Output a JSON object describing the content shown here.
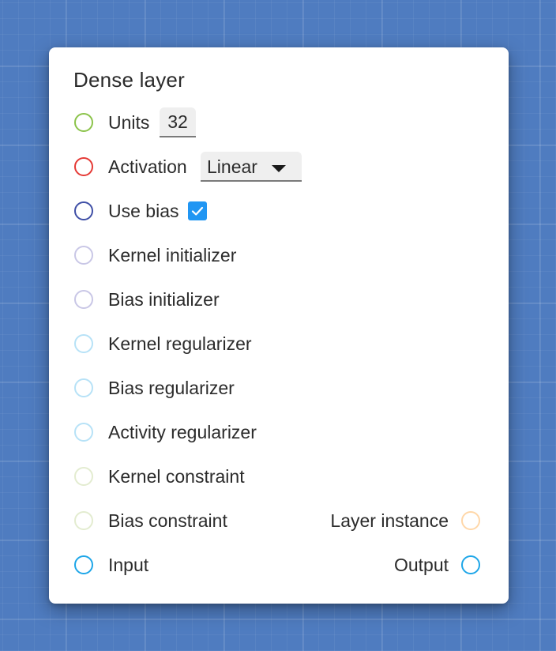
{
  "node": {
    "title": "Dense layer",
    "rows": [
      {
        "label": "Units",
        "port_color": "#8bc34a",
        "input_value": "32"
      },
      {
        "label": "Activation",
        "port_color": "#e53935",
        "select_value": "Linear"
      },
      {
        "label": "Use bias",
        "port_color": "#3f4fa6",
        "checked": true
      },
      {
        "label": "Kernel initializer",
        "port_color": "#c9c7e6"
      },
      {
        "label": "Bias initializer",
        "port_color": "#c9c7e6"
      },
      {
        "label": "Kernel regularizer",
        "port_color": "#b7e2f7"
      },
      {
        "label": "Bias regularizer",
        "port_color": "#b7e2f7"
      },
      {
        "label": "Activity regularizer",
        "port_color": "#b7e2f7"
      },
      {
        "label": "Kernel constraint",
        "port_color": "#e3ecd0"
      },
      {
        "label": "Bias constraint",
        "port_color": "#e3ecd0"
      },
      {
        "label": "Input",
        "port_color": "#1ea6e8"
      }
    ],
    "outputs": [
      {
        "label": "Layer instance",
        "port_color": "#ffd7a8"
      },
      {
        "label": "Output",
        "port_color": "#1ea6e8"
      }
    ]
  },
  "colors": {
    "background": "#4f7cc0",
    "checkbox": "#2196f3"
  }
}
